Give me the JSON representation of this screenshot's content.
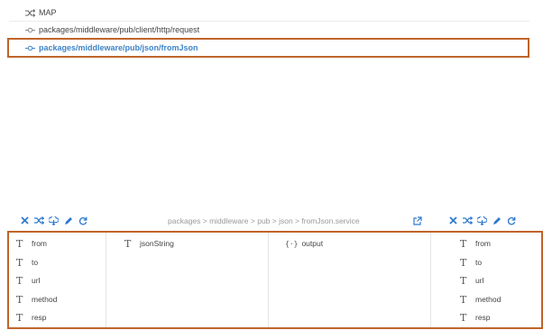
{
  "steps": [
    {
      "icon": "map-icon",
      "label": "MAP"
    },
    {
      "icon": "invoke-icon",
      "label": "packages/middleware/pub/client/http/request"
    },
    {
      "icon": "invoke-icon",
      "label": "packages/middleware/pub/json/fromJson"
    }
  ],
  "toolbar": {
    "path": "packages > middleware > pub > json > fromJson.service"
  },
  "pipeline_in": [
    "from",
    "to",
    "url",
    "method",
    "resp"
  ],
  "service_in": [
    "jsonString"
  ],
  "service_out": [
    "output"
  ],
  "pipeline_out": [
    "from",
    "to",
    "url",
    "method",
    "resp"
  ],
  "colors": {
    "accent": "#2f7ad0",
    "selection_border": "#c0642a",
    "selected_text": "#3d84c9"
  }
}
